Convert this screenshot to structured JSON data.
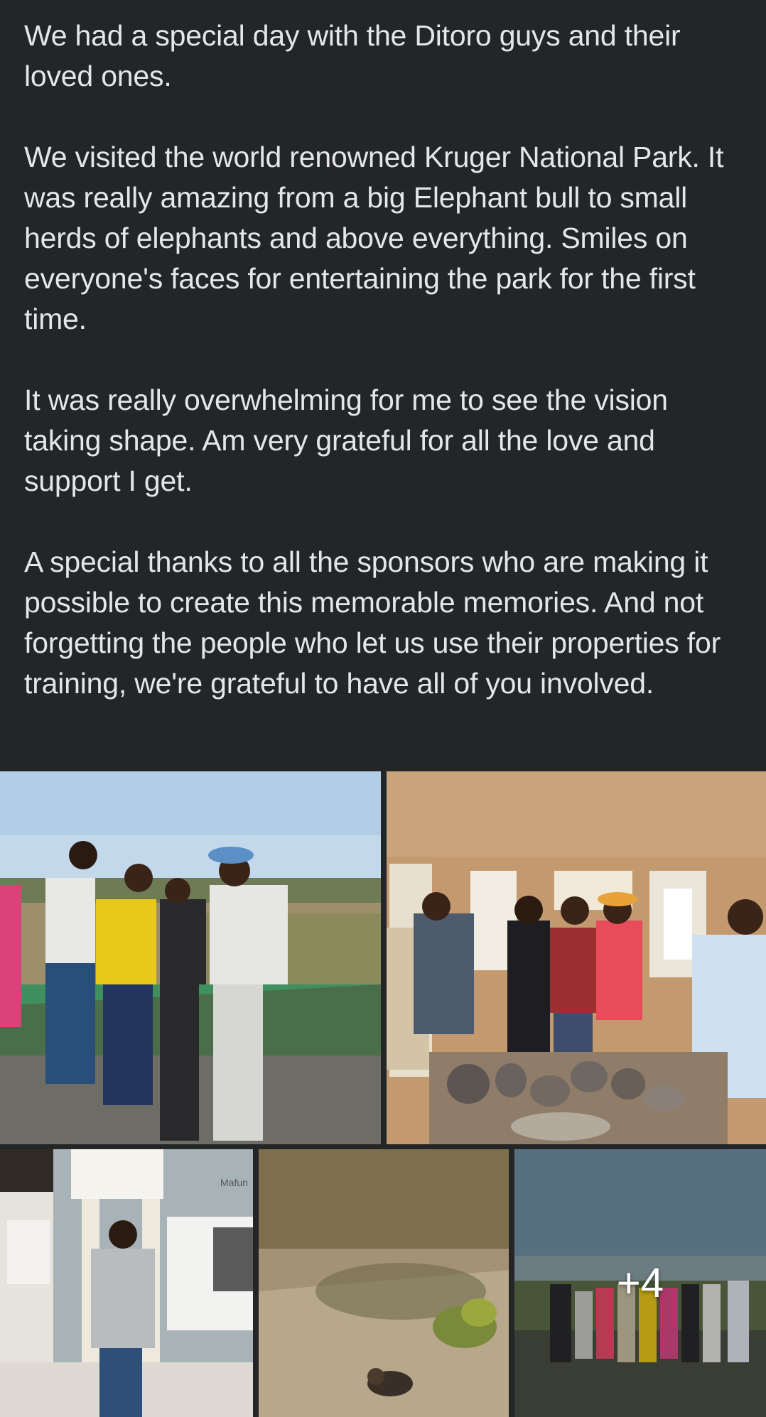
{
  "post": {
    "paragraphs": [
      "We had a special day with the Ditoro guys and their loved ones.",
      "We visited the world renowned Kruger National Park. It was really amazing from a big Elephant bull to small herds of elephants and above everything. Smiles on everyone's faces for entertaining the park for the first time.",
      "It was really overwhelming for me to see the vision taking shape. Am very grateful for all the love and support I get.",
      "A special thanks to all the sponsors who are making it possible to create this memorable memories. And not forgetting the people who let us use their properties  for training, we're grateful to have all of you involved."
    ]
  },
  "photos": {
    "museum_sign": "Mafun",
    "more_count": "+4"
  },
  "colors": {
    "background": "#242526",
    "text": "#e4e6eb",
    "sky": "#b9d3ea",
    "wall": "#c59a6d"
  }
}
